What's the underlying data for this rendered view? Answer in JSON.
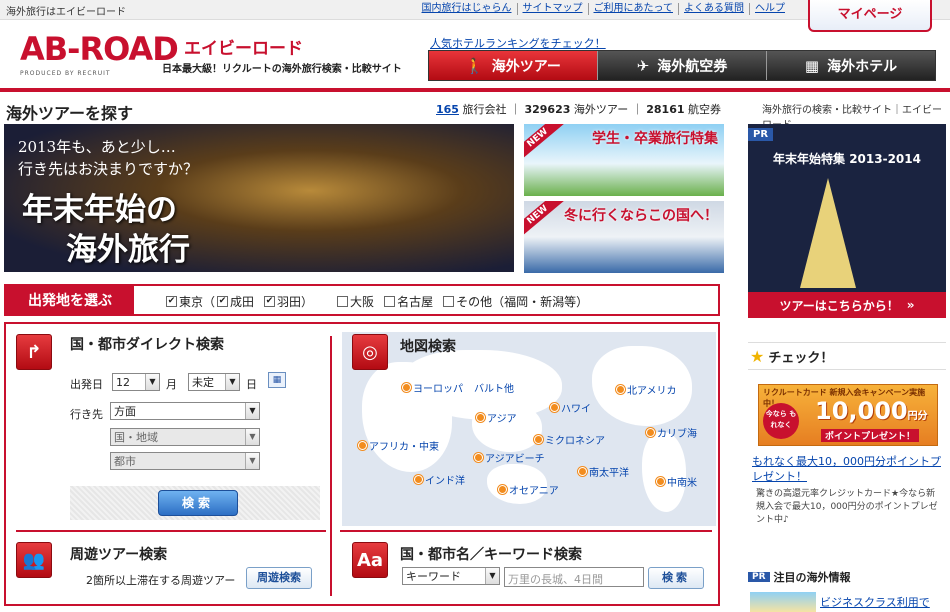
{
  "topbar": {
    "tagline": "海外旅行はエイビーロード",
    "links": [
      "国内旅行はじゃらん",
      "サイトマップ",
      "ご利用にあたって",
      "よくある質問",
      "ヘルプ"
    ],
    "mypage": "マイページ"
  },
  "header": {
    "logo": "AB-ROAD",
    "logo_kana": "エイビーロード",
    "tagline": "日本最大級！リクルートの海外旅行検索・比較サイト",
    "produced": "PRODUCED BY RECRUIT",
    "hotel_ranking_link": "人気ホテルランキングをチェック！",
    "tabs": [
      {
        "label": "海外ツアー",
        "icon": "people-icon",
        "active": true
      },
      {
        "label": "海外航空券",
        "icon": "airplane-icon",
        "active": false
      },
      {
        "label": "海外ホテル",
        "icon": "building-icon",
        "active": false
      }
    ]
  },
  "page": {
    "title": "海外ツアーを探す",
    "counts": {
      "agencies": "165",
      "agencies_label": "旅行会社",
      "tours": "329623",
      "tours_label": "海外ツアー",
      "flights": "28161",
      "flights_label": "航空券"
    },
    "right_tagline": "海外旅行の検索・比較サイト｜エイビーロード"
  },
  "hero": {
    "line1": "2013年も、あと少し…",
    "line2": "行き先はお決まりですか？",
    "line3": "年末年始の",
    "line4": "海外旅行"
  },
  "banners": [
    {
      "new": "NEW",
      "text": "学生・卒業旅行特集"
    },
    {
      "new": "NEW",
      "text": "冬に行くならこの国へ！"
    }
  ],
  "pr": {
    "tag": "PR",
    "title": "年末年始特集 2013-2014",
    "cta": "ツアーはこちらから！"
  },
  "departure": {
    "label": "出発地を選ぶ",
    "options": [
      {
        "label": "東京（",
        "checked": true
      },
      {
        "label": "成田",
        "checked": true
      },
      {
        "label": "羽田）",
        "checked": true
      },
      {
        "label": "大阪",
        "checked": false
      },
      {
        "label": "名古屋",
        "checked": false
      },
      {
        "label": "その他（福岡・新潟等）",
        "checked": false
      }
    ]
  },
  "direct_search": {
    "title": "国・都市ダイレクト検索",
    "date_label": "出発日",
    "month_value": "12",
    "month_unit": "月",
    "day_value": "未定",
    "day_unit": "日",
    "dest_label": "行き先",
    "dest_value": "方面",
    "country_value": "国・地域",
    "city_value": "都市",
    "button": "検索"
  },
  "map_search": {
    "title": "地図検索",
    "regions": [
      "ヨーロッパ",
      "バルト他",
      "アジア",
      "ハワイ",
      "北アメリカ",
      "アフリカ・中東",
      "ミクロネシア",
      "カリブ海",
      "アジアビーチ",
      "インド洋",
      "南太平洋",
      "オセアニア",
      "中南米"
    ]
  },
  "tour_search": {
    "title": "周遊ツアー検索",
    "desc": "2箇所以上滞在する周遊ツアー",
    "button": "周遊検索"
  },
  "keyword_search": {
    "title": "国・都市名／キーワード検索",
    "select_value": "キーワード",
    "placeholder": "万里の長城、4日間",
    "button": "検索"
  },
  "sidebar": {
    "check_title": "チェック！",
    "card_ad_top": "リクルートカード 新規入会キャンペーン実施中！",
    "card_badge": "今なら もれなく",
    "card_amount": "10,000",
    "card_amount_unit": "円分",
    "card_sub": "ポイントプレゼント！",
    "card_link": "もれなく最大10，000円分ポイントプレゼント！",
    "card_desc": "驚きの高還元率クレジットカード★今なら新規入会で最大10，000円分のポイントプレゼント中♪",
    "notice_tag": "PR",
    "notice_title": "注目の海外情報",
    "notice_link": "ビジネスクラス利用で"
  }
}
